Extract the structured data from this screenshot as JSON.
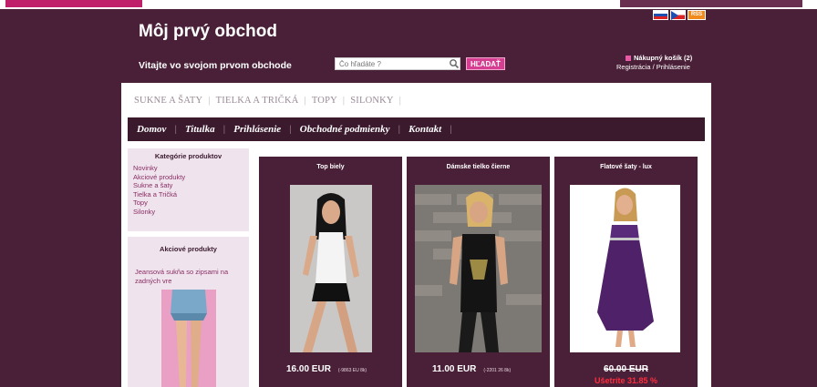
{
  "header": {
    "shop_title": "Môj prvý obchod",
    "welcome": "Vitajte vo svojom prvom obchode",
    "search_placeholder": "Čo hľadáte ?",
    "search_button": "HĽADAŤ",
    "cart_label": "Nákupný košík (2)",
    "auth_links": "Registrácia / Prihlásenie",
    "flags": [
      "sk-flag",
      "cz-flag",
      "rss-icon"
    ],
    "rss_text": "RSS"
  },
  "category_nav": [
    "SUKNE A ŠATY",
    "TIELKA A TRIČKÁ",
    "TOPY",
    "SILONKY"
  ],
  "main_nav": [
    "Domov",
    "Titulka",
    "Prihlásenie",
    "Obchodné podmienky",
    "Kontakt"
  ],
  "sidebar": {
    "categories_title": "Kategórie produktov",
    "categories": [
      "Novinky",
      "Akciové produkty",
      "Sukne a šaty",
      "Tielka a Tričká",
      "Topy",
      "Silonky"
    ],
    "promo_title": "Akciové produkty",
    "promo_text": "Jeansová sukňa so zipsami na zadných vre"
  },
  "products": [
    {
      "name": "Top biely",
      "price": "16.00 EUR",
      "code": "(-9863 EU 8k)"
    },
    {
      "name": "Dámske tielko čierne",
      "price": "11.00 EUR",
      "code": "(-2201 26 8k)"
    },
    {
      "name": "Flatové šaty - lux",
      "price_old": "60.00 EUR",
      "discount": "Ušetríte 31.85 %"
    }
  ],
  "colors": {
    "background": "#4a2038",
    "nav_bar": "#3b1a2e",
    "accent": "#d63f91",
    "sidebar_bg": "#efe4ee",
    "discount": "#ff2d3c"
  }
}
